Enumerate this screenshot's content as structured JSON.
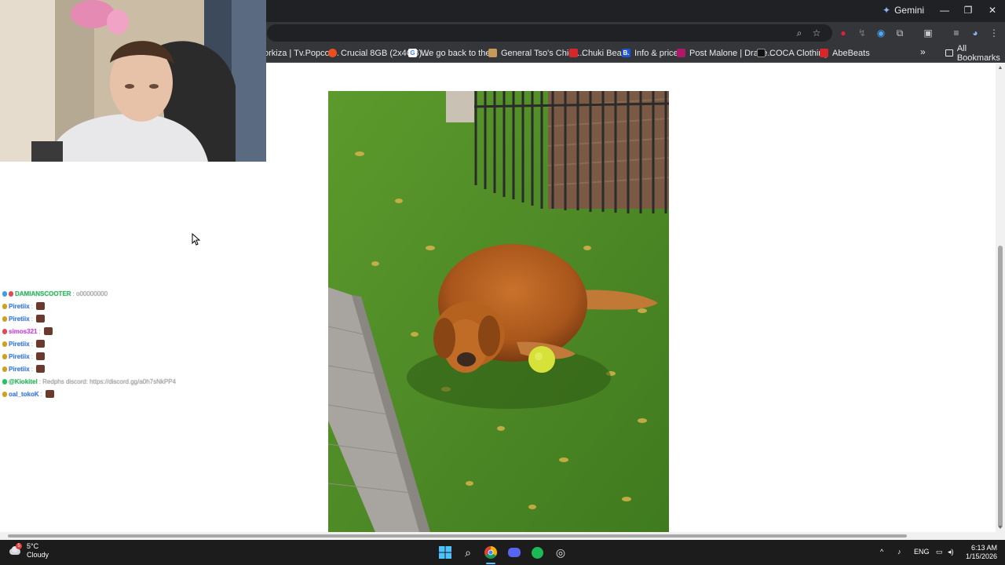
{
  "browser": {
    "gemini_label": "Gemini",
    "bookmarks": [
      {
        "label": "orkiza | Tv.Popcor...",
        "fav_color": "#555555",
        "fav_glyph": ""
      },
      {
        "label": "Crucial 8GB (2x4GB)...",
        "fav_color": "#e8501c",
        "fav_glyph": ""
      },
      {
        "label": "We go back to the...",
        "fav_color": "#ffffff",
        "fav_glyph": "G"
      },
      {
        "label": "General Tso's Chick...",
        "fav_color": "#c89a5a",
        "fav_glyph": ""
      },
      {
        "label": "Chuki Beats",
        "fav_color": "#d6282b",
        "fav_glyph": ""
      },
      {
        "label": "Info & prices",
        "fav_color": "#1a56d6",
        "fav_glyph": "B."
      },
      {
        "label": "Post Malone | Drake...",
        "fav_color": "#b0176b",
        "fav_glyph": ""
      },
      {
        "label": "COCA Clothing",
        "fav_color": "#111111",
        "fav_glyph": ""
      },
      {
        "label": "AbeBeats",
        "fav_color": "#d6282b",
        "fav_glyph": ""
      }
    ],
    "all_bookmarks_label": "All Bookmarks"
  },
  "chat": {
    "messages": [
      {
        "user": "DAMIANSCOOTER",
        "color": "#22c55e",
        "badges": [
          "#3aa0e0",
          "#e04a5a"
        ],
        "text": ": o00000000",
        "emote": false
      },
      {
        "user": "Piretiix",
        "color": "#3b82f6",
        "badges": [
          "#d4a017"
        ],
        "text": ":",
        "emote": true
      },
      {
        "user": "Piretiix",
        "color": "#3b82f6",
        "badges": [
          "#d4a017"
        ],
        "text": ":",
        "emote": true
      },
      {
        "user": "simos321",
        "color": "#d946ef",
        "badges": [
          "#e04a5a"
        ],
        "text": ":",
        "emote": true
      },
      {
        "user": "Piretiix",
        "color": "#3b82f6",
        "badges": [
          "#d4a017"
        ],
        "text": ":",
        "emote": true
      },
      {
        "user": "Piretiix",
        "color": "#3b82f6",
        "badges": [
          "#d4a017"
        ],
        "text": ":",
        "emote": true
      },
      {
        "user": "Piretiix",
        "color": "#3b82f6",
        "badges": [
          "#d4a017"
        ],
        "text": ":",
        "emote": true
      },
      {
        "user": "@Kiokitel",
        "color": "#22c55e",
        "badges": [
          "#22c55e"
        ],
        "text": ": Redphs discord: https://discord.gg/a0h7sNkPP4",
        "emote": false
      },
      {
        "user": "oal_tokoK",
        "color": "#3b82f6",
        "badges": [
          "#d4a017"
        ],
        "text": ":",
        "emote": true
      }
    ]
  },
  "taskbar": {
    "temperature": "5°C",
    "condition": "Cloudy",
    "language": "ENG",
    "time": "6:13 AM",
    "date": "1/15/2026",
    "weather_badge": "5"
  }
}
